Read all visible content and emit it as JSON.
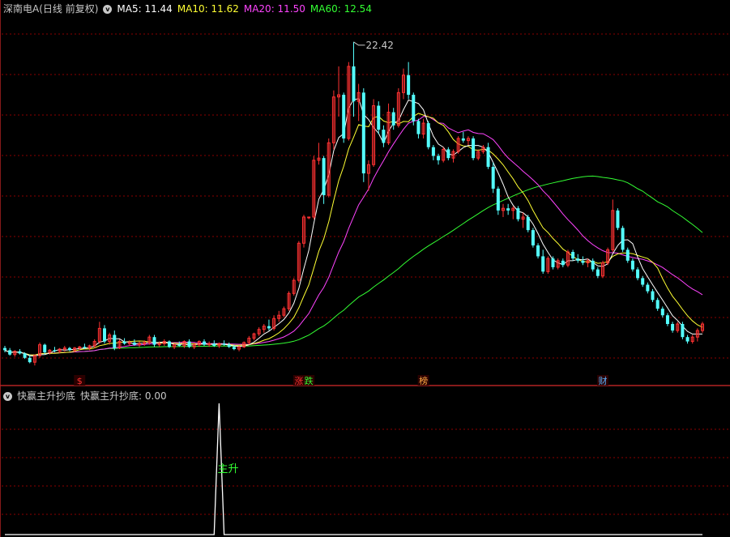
{
  "header": {
    "stock_title": "深南电A(日线 前复权)",
    "ma5": "MA5: 11.44",
    "ma10": "MA10: 11.62",
    "ma20": "MA20: 11.50",
    "ma60": "MA60: 12.54"
  },
  "indicator": {
    "name": "快赢主升抄底",
    "value": "快赢主升抄底: 0.00",
    "signal_label": "主升"
  },
  "colors": {
    "up": "#ff3232",
    "down": "#54ffff",
    "ma5": "#ffffff",
    "ma10": "#ffff33",
    "ma20": "#ff44ff",
    "ma60": "#33ff33",
    "grid": "#8b0000",
    "frame": "#b22222"
  },
  "chart_data": [
    {
      "type": "candlestick",
      "price_range": [
        7.2,
        23.6
      ],
      "max_price_label": "22.42",
      "candles": [
        [
          8.4,
          8.5,
          8.2,
          8.3
        ],
        [
          8.3,
          8.4,
          8.05,
          8.1
        ],
        [
          8.1,
          8.3,
          8.0,
          8.25
        ],
        [
          8.25,
          8.35,
          8.1,
          8.15
        ],
        [
          8.15,
          8.2,
          7.9,
          7.95
        ],
        [
          7.95,
          8.1,
          7.7,
          7.75
        ],
        [
          7.75,
          8.1,
          7.6,
          8.05
        ],
        [
          8.05,
          8.65,
          7.95,
          8.55
        ],
        [
          8.55,
          8.6,
          8.1,
          8.2
        ],
        [
          8.2,
          8.35,
          8.1,
          8.3
        ],
        [
          8.3,
          8.45,
          8.2,
          8.25
        ],
        [
          8.25,
          8.4,
          8.15,
          8.35
        ],
        [
          8.35,
          8.5,
          8.25,
          8.4
        ],
        [
          8.4,
          8.45,
          8.25,
          8.3
        ],
        [
          8.3,
          8.45,
          8.2,
          8.4
        ],
        [
          8.4,
          8.5,
          8.3,
          8.45
        ],
        [
          8.45,
          8.6,
          8.35,
          8.4
        ],
        [
          8.4,
          8.55,
          8.3,
          8.5
        ],
        [
          8.5,
          8.8,
          8.4,
          8.7
        ],
        [
          8.7,
          9.6,
          8.6,
          9.3
        ],
        [
          9.3,
          9.45,
          8.6,
          8.7
        ],
        [
          8.7,
          9.1,
          8.55,
          9.0
        ],
        [
          9.0,
          9.2,
          8.3,
          8.4
        ],
        [
          8.4,
          8.8,
          8.35,
          8.7
        ],
        [
          8.7,
          8.85,
          8.55,
          8.6
        ],
        [
          8.6,
          8.75,
          8.5,
          8.65
        ],
        [
          8.65,
          8.8,
          8.5,
          8.55
        ],
        [
          8.55,
          8.7,
          8.45,
          8.6
        ],
        [
          8.6,
          8.75,
          8.5,
          8.65
        ],
        [
          8.65,
          9.0,
          8.55,
          8.9
        ],
        [
          8.9,
          9.0,
          8.45,
          8.55
        ],
        [
          8.55,
          8.7,
          8.45,
          8.6
        ],
        [
          8.6,
          8.8,
          8.5,
          8.7
        ],
        [
          8.7,
          8.75,
          8.4,
          8.45
        ],
        [
          8.45,
          8.6,
          8.35,
          8.55
        ],
        [
          8.55,
          8.7,
          8.45,
          8.5
        ],
        [
          8.5,
          8.75,
          8.4,
          8.7
        ],
        [
          8.7,
          8.8,
          8.4,
          8.45
        ],
        [
          8.45,
          8.65,
          8.35,
          8.55
        ],
        [
          8.55,
          8.75,
          8.45,
          8.7
        ],
        [
          8.7,
          8.8,
          8.5,
          8.55
        ],
        [
          8.55,
          8.7,
          8.45,
          8.6
        ],
        [
          8.6,
          8.75,
          8.45,
          8.5
        ],
        [
          8.5,
          8.65,
          8.4,
          8.6
        ],
        [
          8.6,
          8.75,
          8.5,
          8.55
        ],
        [
          8.55,
          8.65,
          8.4,
          8.45
        ],
        [
          8.45,
          8.55,
          8.3,
          8.35
        ],
        [
          8.35,
          8.5,
          8.25,
          8.45
        ],
        [
          8.45,
          8.7,
          8.4,
          8.65
        ],
        [
          8.65,
          8.95,
          8.55,
          8.85
        ],
        [
          8.85,
          9.1,
          8.75,
          9.05
        ],
        [
          9.05,
          9.35,
          8.95,
          9.25
        ],
        [
          9.25,
          9.5,
          9.1,
          9.4
        ],
        [
          9.4,
          9.7,
          9.2,
          9.3
        ],
        [
          9.3,
          9.9,
          9.2,
          9.75
        ],
        [
          9.75,
          10.1,
          9.6,
          9.9
        ],
        [
          9.9,
          10.3,
          9.8,
          10.2
        ],
        [
          10.2,
          11.0,
          10.1,
          10.9
        ],
        [
          10.9,
          11.6,
          10.8,
          11.5
        ],
        [
          11.5,
          13.3,
          11.4,
          13.2
        ],
        [
          13.2,
          14.5,
          13.0,
          14.4
        ],
        [
          14.4,
          14.4,
          14.3,
          14.4
        ],
        [
          14.4,
          17.2,
          14.3,
          17.0
        ],
        [
          17.0,
          17.8,
          16.8,
          17.1
        ],
        [
          17.1,
          17.2,
          15.0,
          15.4
        ],
        [
          15.4,
          18.0,
          15.3,
          17.8
        ],
        [
          17.8,
          20.2,
          17.5,
          19.9
        ],
        [
          19.9,
          21.3,
          19.0,
          20.0
        ],
        [
          20.0,
          20.1,
          17.8,
          18.0
        ],
        [
          18.0,
          21.5,
          17.9,
          21.3
        ],
        [
          21.3,
          22.42,
          19.0,
          19.7
        ],
        [
          19.7,
          20.5,
          18.8,
          20.1
        ],
        [
          20.1,
          20.3,
          16.0,
          16.4
        ],
        [
          16.4,
          17.0,
          15.6,
          16.8
        ],
        [
          16.8,
          19.8,
          16.7,
          19.5
        ],
        [
          19.5,
          19.7,
          18.2,
          18.4
        ],
        [
          18.4,
          18.6,
          17.6,
          17.8
        ],
        [
          17.8,
          19.6,
          17.7,
          19.2
        ],
        [
          19.2,
          19.4,
          18.4,
          18.6
        ],
        [
          18.6,
          20.3,
          18.5,
          20.1
        ],
        [
          20.1,
          21.2,
          19.8,
          20.9
        ],
        [
          20.9,
          21.5,
          19.8,
          20.0
        ],
        [
          20.0,
          20.1,
          18.6,
          18.8
        ],
        [
          18.8,
          18.9,
          18.0,
          18.2
        ],
        [
          18.2,
          18.9,
          18.0,
          18.7
        ],
        [
          18.7,
          18.8,
          17.5,
          17.6
        ],
        [
          17.6,
          17.7,
          17.0,
          17.2
        ],
        [
          17.2,
          17.3,
          16.8,
          17.0
        ],
        [
          17.0,
          17.6,
          16.9,
          17.5
        ],
        [
          17.5,
          17.6,
          17.0,
          17.1
        ],
        [
          17.1,
          17.5,
          16.9,
          17.4
        ],
        [
          17.4,
          18.1,
          17.3,
          18.0
        ],
        [
          18.0,
          18.3,
          17.8,
          17.9
        ],
        [
          17.9,
          18.1,
          17.7,
          18.0
        ],
        [
          18.0,
          18.1,
          17.0,
          17.1
        ],
        [
          17.1,
          17.5,
          17.0,
          17.4
        ],
        [
          17.4,
          17.7,
          17.3,
          17.6
        ],
        [
          17.6,
          17.8,
          16.6,
          16.7
        ],
        [
          16.7,
          16.9,
          15.5,
          15.7
        ],
        [
          15.7,
          15.8,
          14.5,
          14.7
        ],
        [
          14.7,
          15.0,
          14.4,
          14.8
        ],
        [
          14.8,
          15.0,
          14.5,
          14.7
        ],
        [
          14.7,
          14.9,
          14.3,
          14.8
        ],
        [
          14.8,
          14.9,
          14.2,
          14.3
        ],
        [
          14.3,
          14.6,
          13.9,
          14.4
        ],
        [
          14.4,
          14.5,
          13.7,
          13.8
        ],
        [
          13.8,
          13.9,
          13.0,
          13.1
        ],
        [
          13.1,
          13.2,
          12.5,
          12.6
        ],
        [
          12.6,
          12.9,
          11.8,
          11.9
        ],
        [
          11.9,
          12.6,
          11.8,
          12.5
        ],
        [
          12.5,
          12.6,
          12.0,
          12.1
        ],
        [
          12.1,
          12.5,
          12.0,
          12.4
        ],
        [
          12.4,
          12.5,
          12.1,
          12.2
        ],
        [
          12.2,
          12.9,
          12.1,
          12.8
        ],
        [
          12.8,
          12.9,
          12.4,
          12.5
        ],
        [
          12.5,
          12.7,
          12.3,
          12.4
        ],
        [
          12.4,
          12.6,
          12.2,
          12.3
        ],
        [
          12.3,
          12.5,
          12.1,
          12.4
        ],
        [
          12.4,
          12.5,
          11.9,
          12.0
        ],
        [
          12.0,
          12.1,
          11.6,
          11.7
        ],
        [
          11.7,
          12.4,
          11.6,
          12.3
        ],
        [
          12.3,
          13.0,
          12.2,
          12.9
        ],
        [
          12.9,
          15.2,
          12.8,
          14.7
        ],
        [
          14.7,
          14.8,
          13.8,
          13.9
        ],
        [
          13.9,
          14.0,
          12.8,
          12.9
        ],
        [
          12.9,
          13.0,
          12.3,
          12.4
        ],
        [
          12.4,
          12.5,
          11.9,
          12.0
        ],
        [
          12.0,
          12.1,
          11.5,
          11.6
        ],
        [
          11.6,
          11.7,
          11.2,
          11.3
        ],
        [
          11.3,
          11.4,
          10.9,
          11.0
        ],
        [
          11.0,
          11.1,
          10.5,
          10.6
        ],
        [
          10.6,
          10.7,
          10.1,
          10.2
        ],
        [
          10.2,
          10.3,
          9.8,
          9.9
        ],
        [
          9.9,
          10.0,
          9.4,
          9.5
        ],
        [
          9.5,
          9.6,
          9.1,
          9.2
        ],
        [
          9.2,
          9.6,
          9.1,
          9.5
        ],
        [
          9.5,
          9.6,
          8.8,
          8.9
        ],
        [
          8.9,
          9.0,
          8.6,
          8.7
        ],
        [
          8.7,
          9.0,
          8.6,
          8.9
        ],
        [
          8.9,
          9.3,
          8.7,
          9.2
        ],
        [
          9.2,
          9.6,
          9.1,
          9.5
        ]
      ],
      "ma_lines": [
        "MA5",
        "MA10",
        "MA20",
        "MA60"
      ],
      "event_markers": [
        {
          "label": "$",
          "color": "#ff3232",
          "index": 15
        },
        {
          "label": "涨",
          "color": "#ff3232",
          "index": 59
        },
        {
          "label": "跌",
          "color": "#33ff33",
          "index": 61
        },
        {
          "label": "榜",
          "color": "#ffaa44",
          "index": 84
        },
        {
          "label": "财",
          "color": "#5ab4ff",
          "index": 120
        }
      ]
    },
    {
      "type": "line",
      "title": "快赢主升抄底",
      "value_range": [
        0,
        1
      ],
      "spike_index": 43,
      "spike_value": 1,
      "other_values": 0
    }
  ]
}
